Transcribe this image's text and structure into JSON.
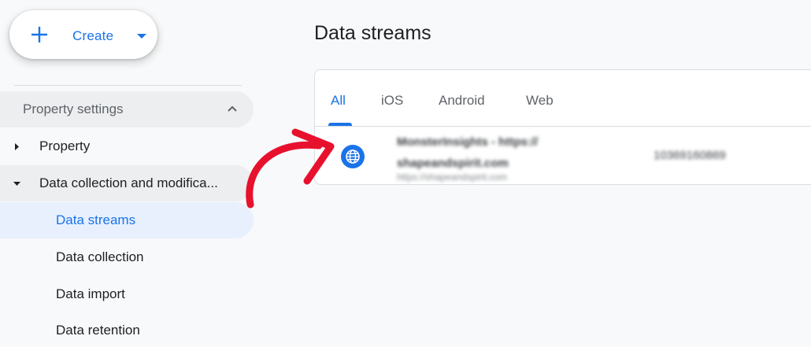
{
  "create_button": {
    "label": "Create"
  },
  "sidebar": {
    "section": {
      "label": "Property settings"
    },
    "items": [
      {
        "label": "Property"
      },
      {
        "label": "Data collection and modifica..."
      }
    ],
    "subitems": [
      {
        "label": "Data streams",
        "active": true
      },
      {
        "label": "Data collection"
      },
      {
        "label": "Data import"
      },
      {
        "label": "Data retention"
      }
    ]
  },
  "main": {
    "title": "Data streams",
    "tabs": [
      {
        "label": "All",
        "active": true
      },
      {
        "label": "iOS"
      },
      {
        "label": "Android"
      },
      {
        "label": "Web"
      }
    ],
    "stream": {
      "icon": "globe-icon",
      "name": "MonsterInsights - https:// shapeandspirit.com",
      "url": "https://shapeandspirit.com",
      "id": "10369160869"
    }
  },
  "colors": {
    "accent": "#1a73e8",
    "active_bg": "#e8f0fe",
    "annotation": "#e8112d"
  }
}
